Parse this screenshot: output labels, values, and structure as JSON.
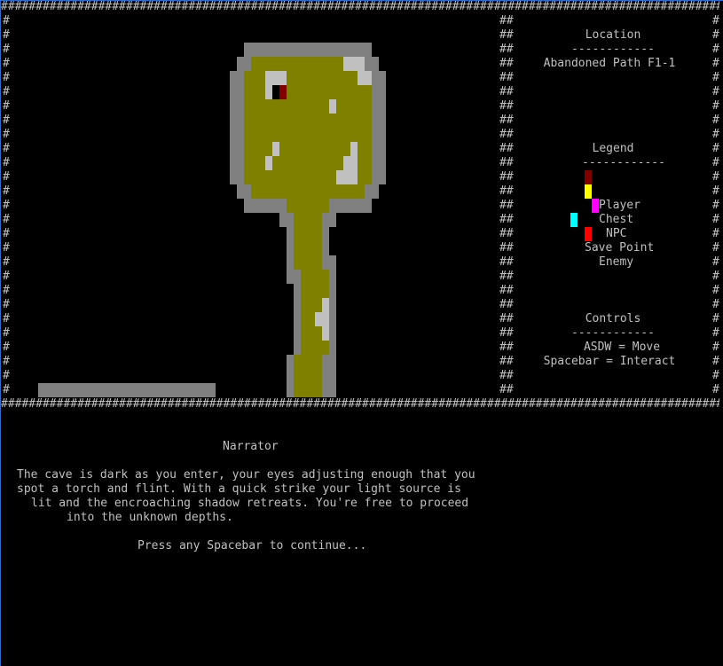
{
  "border_char": "#",
  "side_panel": {
    "location_header": "Location",
    "location_divider": "------------",
    "location_name": "Abandoned Path F1-1",
    "legend_header": "Legend",
    "legend_divider": "------------",
    "legend": [
      {
        "label": "Player",
        "color": "#800000"
      },
      {
        "label": "Chest",
        "color": "#ffff00"
      },
      {
        "label": "NPC",
        "color": "#ff00ff"
      },
      {
        "label": "Save Point",
        "color": "#00ffff"
      },
      {
        "label": "Enemy",
        "color": "#ff0000"
      }
    ],
    "controls_header": "Controls",
    "controls_divider": "------------",
    "controls": [
      "ASDW = Move",
      "Spacebar = Interact"
    ]
  },
  "colors": {
    "wall": "#808080",
    "floor": "#808000",
    "rock": "#c0c0c0",
    "player": "#800000"
  },
  "dialog": {
    "speaker": "Narrator",
    "lines": [
      "The cave is dark as you enter, your eyes adjusting enough that you",
      "spot a torch and flint. With a quick strike your light source is",
      "lit and the encroaching shadow retreats. You're free to proceed",
      "into the unknown depths."
    ],
    "prompt": "Press any Spacebar to continue..."
  }
}
